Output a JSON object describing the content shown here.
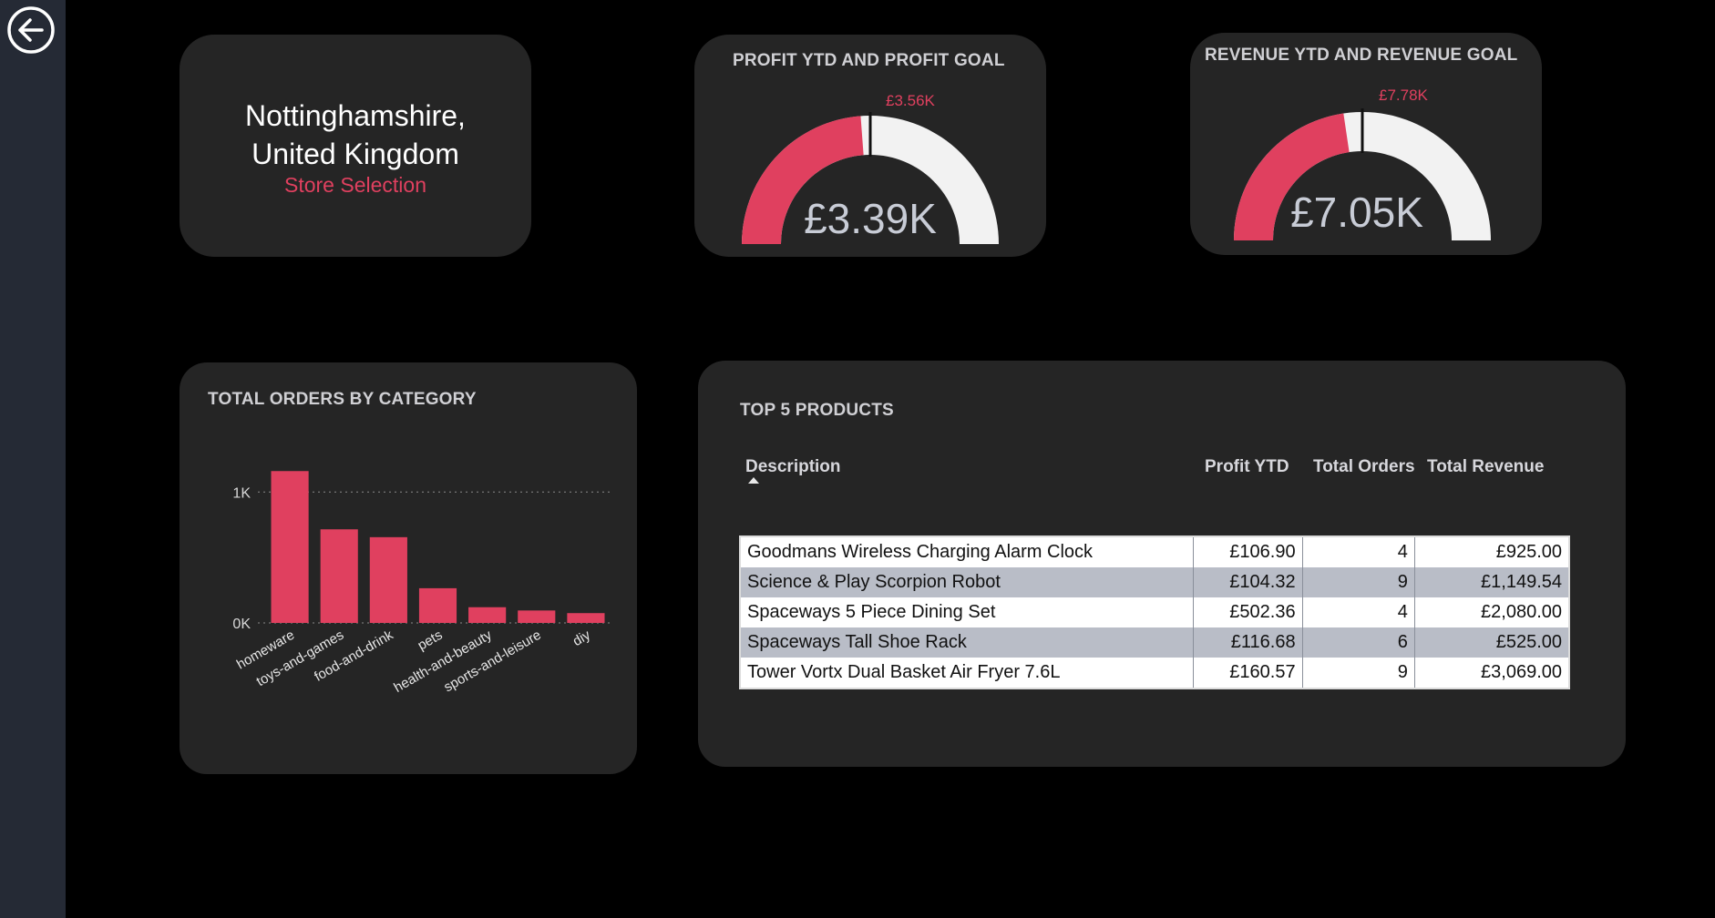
{
  "nav": {
    "back_icon": "back-arrow-circle-icon"
  },
  "colors": {
    "accent": "#e0405f",
    "card": "#252525",
    "background": "#000000",
    "gauge_track": "#f2f2f2"
  },
  "store": {
    "name_line1": "Nottinghamshire,",
    "name_line2": "United Kingdom",
    "subtitle": "Store Selection"
  },
  "profit_gauge": {
    "title": "PROFIT YTD AND PROFIT GOAL",
    "value_label": "£3.39K",
    "goal_label": "£3.56K",
    "value": 3.39,
    "goal": 3.56,
    "max": 7.12
  },
  "revenue_gauge": {
    "title": "REVENUE YTD AND REVENUE GOAL",
    "value_label": "£7.05K",
    "goal_label": "£7.78K",
    "value": 7.05,
    "goal": 7.78,
    "max": 15.56
  },
  "orders_chart": {
    "title": "TOTAL ORDERS BY CATEGORY"
  },
  "chart_data": {
    "type": "bar",
    "title": "TOTAL ORDERS BY CATEGORY",
    "categories": [
      "homeware",
      "toys-and-games",
      "food-and-drink",
      "pets",
      "health-and-beauty",
      "sports-and-leisure",
      "diy"
    ],
    "values": [
      1160,
      715,
      655,
      265,
      120,
      95,
      75
    ],
    "yticks": [
      {
        "value": 0,
        "label": "0K"
      },
      {
        "value": 1000,
        "label": "1K"
      }
    ],
    "ylim": [
      0,
      1280
    ],
    "grid": true
  },
  "top_products": {
    "title": "TOP 5 PRODUCTS",
    "columns": [
      "Description",
      "Profit YTD",
      "Total Orders",
      "Total Revenue"
    ],
    "rows": [
      [
        "Goodmans Wireless Charging Alarm Clock",
        "£106.90",
        "4",
        "£925.00"
      ],
      [
        "Science & Play Scorpion Robot",
        "£104.32",
        "9",
        "£1,149.54"
      ],
      [
        "Spaceways 5 Piece Dining Set",
        "£502.36",
        "4",
        "£2,080.00"
      ],
      [
        "Spaceways Tall Shoe Rack",
        "£116.68",
        "6",
        "£525.00"
      ],
      [
        "Tower Vortx Dual Basket Air Fryer 7.6L",
        "£160.57",
        "9",
        "£3,069.00"
      ]
    ]
  }
}
